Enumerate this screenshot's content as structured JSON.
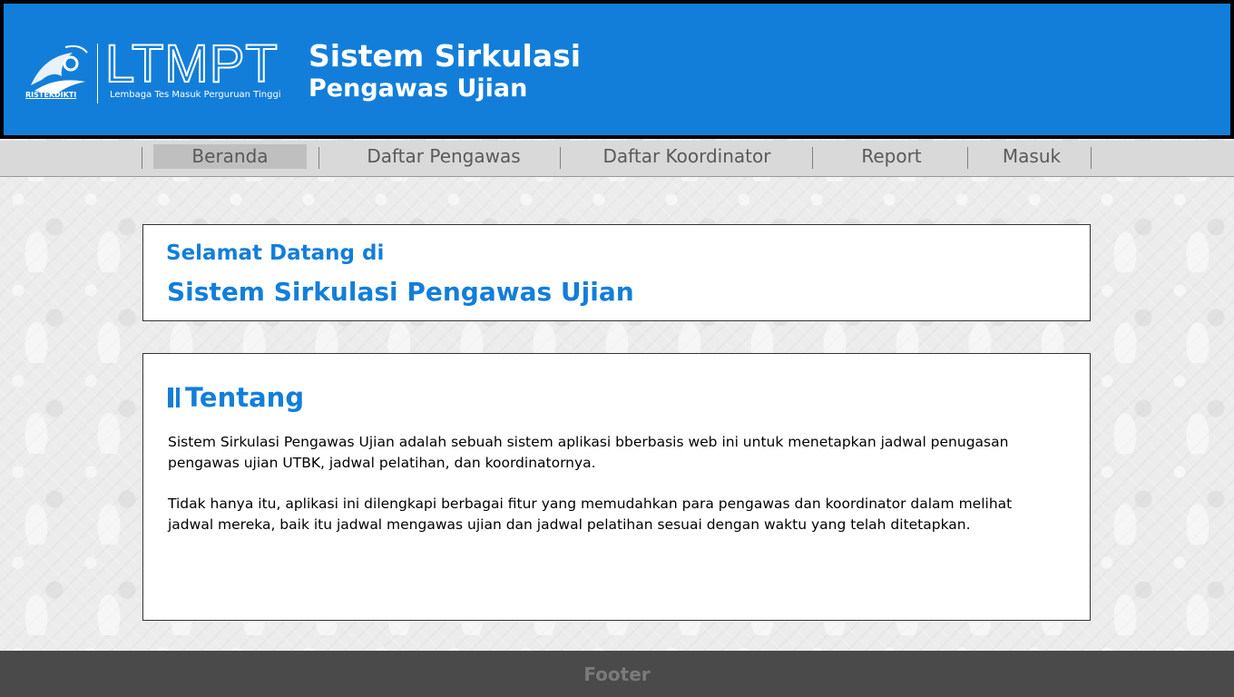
{
  "header": {
    "logo": {
      "wordmark": "LTMPT",
      "subtitle": "Lembaga Tes Masuk Perguruan Tinggi",
      "caption": "RISTEKDIKTI"
    },
    "title_line1": "Sistem Sirkulasi",
    "title_line2": "Pengawas Ujian"
  },
  "nav": {
    "items": [
      {
        "label": "Beranda",
        "active": true
      },
      {
        "label": "Daftar Pengawas",
        "active": false
      },
      {
        "label": "Daftar Koordinator",
        "active": false
      },
      {
        "label": "Report",
        "active": false
      },
      {
        "label": "Masuk",
        "active": false
      }
    ]
  },
  "welcome": {
    "line1": "Selamat Datang di",
    "line2": "Sistem Sirkulasi Pengawas Ujian"
  },
  "about": {
    "icon": "heading-bar-icon",
    "title": "Tentang",
    "paragraphs": [
      "Sistem Sirkulasi Pengawas Ujian adalah sebuah sistem aplikasi bberbasis web ini untuk menetapkan jadwal penugasan pengawas ujian UTBK, jadwal pelatihan, dan koordinatornya.",
      "Tidak hanya itu, aplikasi ini dilengkapi berbagai fitur yang memudahkan para pengawas dan koordinator dalam melihat jadwal mereka, baik itu jadwal mengawas ujian dan jadwal pelatihan sesuai dengan waktu yang telah ditetapkan."
    ]
  },
  "footer": {
    "text": "Footer"
  },
  "colors": {
    "brand_blue": "#137ed9",
    "nav_bg": "#d9d9d9",
    "nav_active_bg": "#bfbfbf",
    "footer_bg": "#4a4a4a"
  }
}
